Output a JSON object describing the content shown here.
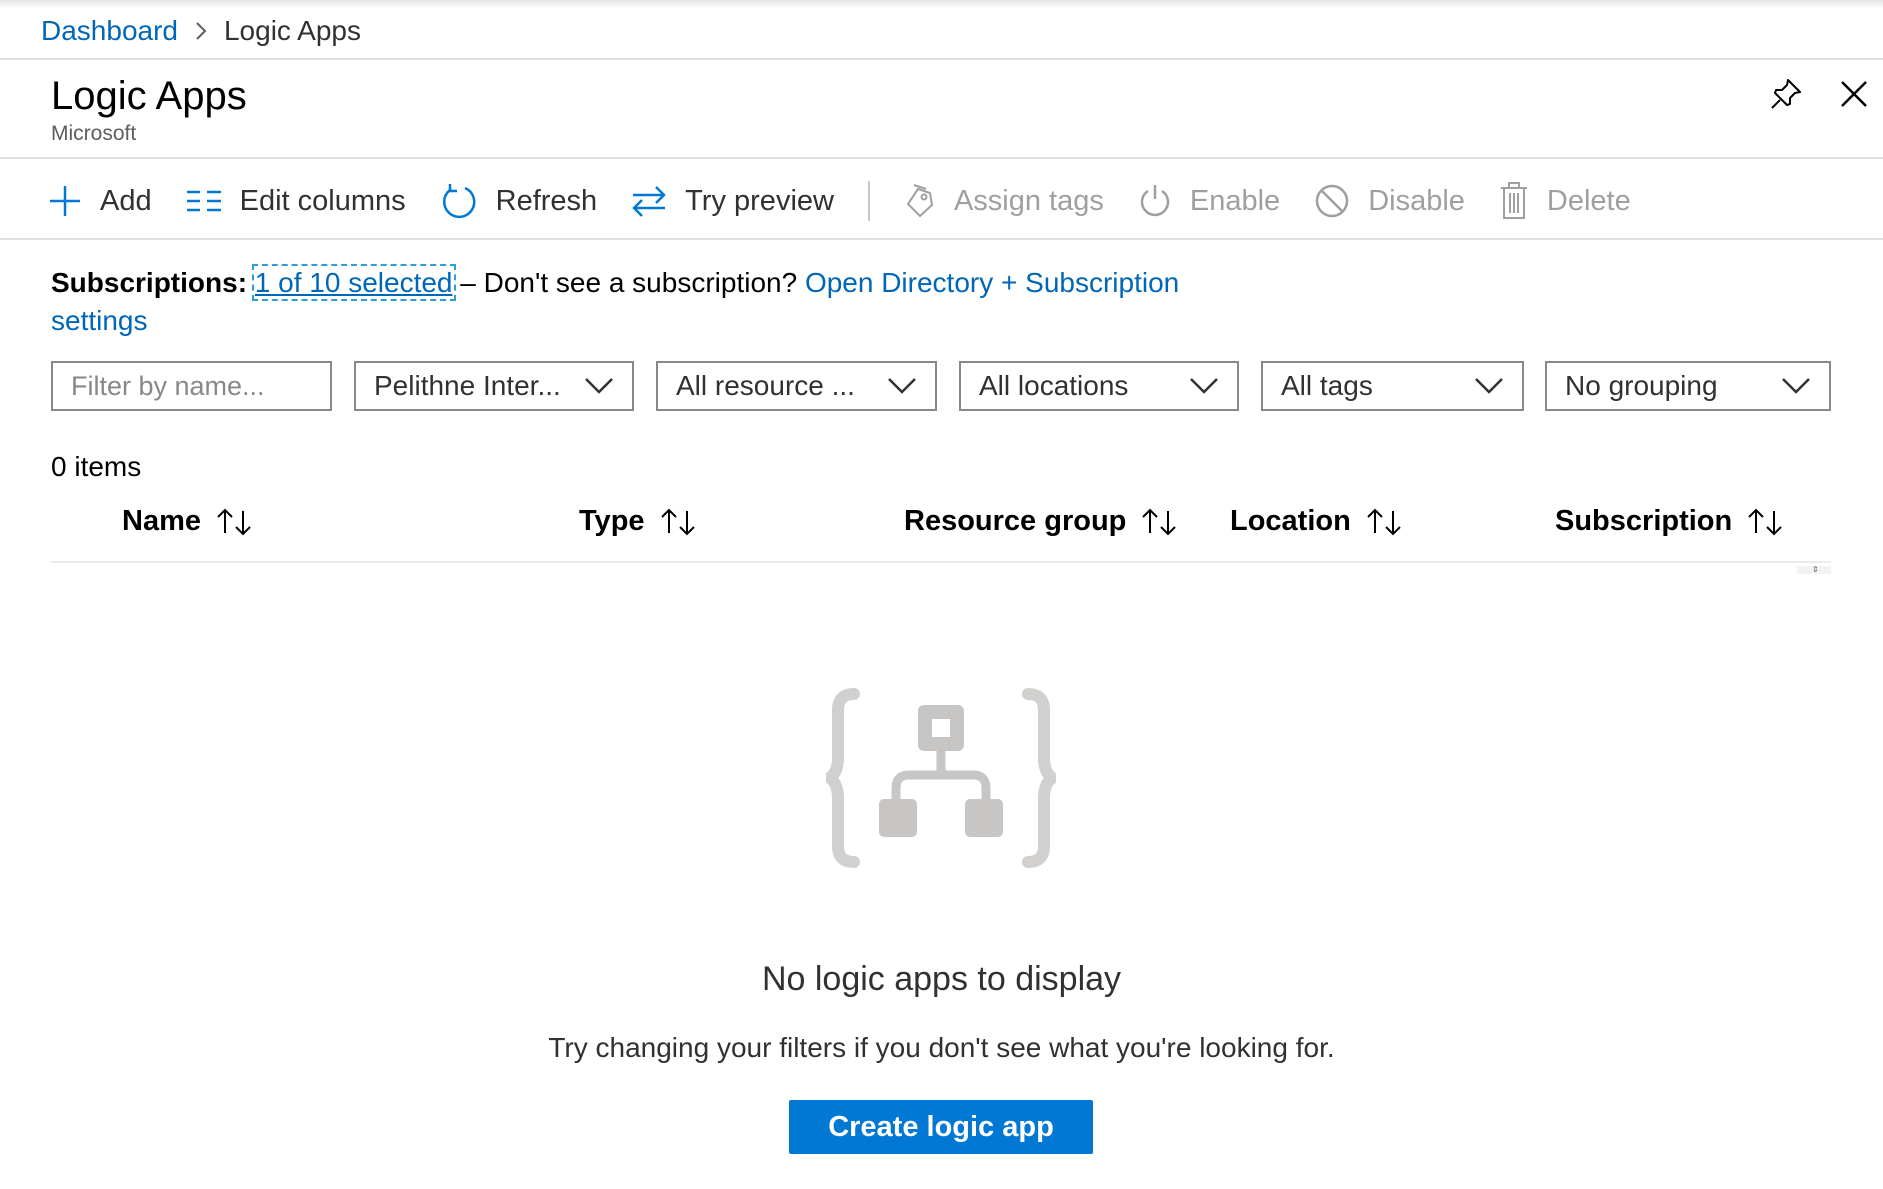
{
  "breadcrumb": {
    "parent": "Dashboard",
    "current": "Logic Apps"
  },
  "header": {
    "title": "Logic Apps",
    "subtitle": "Microsoft"
  },
  "toolbar": {
    "add": "Add",
    "edit_columns": "Edit columns",
    "refresh": "Refresh",
    "try_preview": "Try preview",
    "assign_tags": "Assign tags",
    "enable": "Enable",
    "disable": "Disable",
    "delete": "Delete"
  },
  "subscriptions": {
    "label": "Subscriptions:",
    "selected": "1 of 10 selected",
    "prompt": " – Don't see a subscription? ",
    "link": "Open Directory + Subscription settings"
  },
  "filters": {
    "name_placeholder": "Filter by name...",
    "subscription": "Pelithne Inter...",
    "resource_group": "All resource ...",
    "locations": "All locations",
    "tags": "All tags",
    "grouping": "No grouping"
  },
  "table": {
    "count": "0 items",
    "columns": [
      "Name",
      "Type",
      "Resource group",
      "Location",
      "Subscription"
    ]
  },
  "empty": {
    "title": "No logic apps to display",
    "subtitle": "Try changing your filters if you don't see what you're looking for.",
    "button": "Create logic app"
  },
  "icons": {
    "pin": "pin-icon",
    "close": "close-icon",
    "add": "plus-icon",
    "edit_columns": "columns-icon",
    "refresh": "refresh-icon",
    "try_preview": "swap-arrows-icon",
    "assign_tags": "tag-icon",
    "enable": "power-icon",
    "disable": "disable-icon",
    "delete": "trash-icon",
    "sort": "sort-icon",
    "chevron": "chevron-down-icon",
    "empty": "logic-app-icon"
  },
  "colors": {
    "accent": "#0078d4",
    "link": "#0067b8",
    "disabled": "#a19f9d"
  }
}
